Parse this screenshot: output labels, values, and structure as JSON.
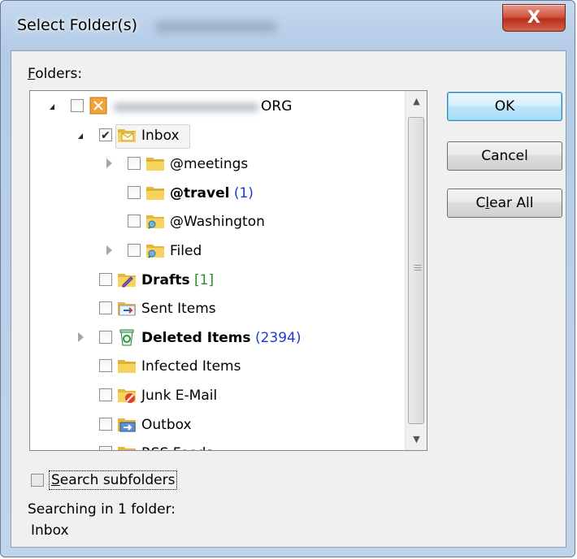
{
  "window": {
    "title": "Select Folder(s)",
    "close_glyph": "X"
  },
  "folders_label_mnemonic": "F",
  "folders_label_rest": "olders:",
  "tree": [
    {
      "label": "ORG",
      "indent": 0,
      "expander": "open",
      "icon": "exchange-account-icon",
      "checked": false,
      "bold": false
    },
    {
      "label": "Inbox",
      "indent": 1,
      "expander": "open",
      "icon": "inbox-icon",
      "checked": true,
      "bold": false,
      "selected": true
    },
    {
      "label": "@meetings",
      "indent": 2,
      "expander": "closed",
      "icon": "folder-icon",
      "checked": false,
      "bold": false
    },
    {
      "label": "@travel",
      "count": "(1)",
      "count_style": "blue",
      "indent": 2,
      "expander": "none",
      "icon": "folder-icon",
      "checked": false,
      "bold": true
    },
    {
      "label": "@Washington",
      "indent": 2,
      "expander": "none",
      "icon": "search-folder-icon",
      "checked": false,
      "bold": false
    },
    {
      "label": "Filed",
      "indent": 2,
      "expander": "closed",
      "icon": "search-folder-icon",
      "checked": false,
      "bold": false
    },
    {
      "label": "Drafts",
      "count": "[1]",
      "count_style": "green",
      "indent": 1,
      "expander": "none",
      "icon": "drafts-icon",
      "checked": false,
      "bold": true
    },
    {
      "label": "Sent Items",
      "indent": 1,
      "expander": "none",
      "icon": "sent-items-icon",
      "checked": false,
      "bold": false
    },
    {
      "label": "Deleted Items",
      "count": "(2394)",
      "count_style": "blue",
      "indent": 1,
      "expander": "closed",
      "icon": "recycle-bin-icon",
      "checked": false,
      "bold": true
    },
    {
      "label": "Infected Items",
      "indent": 1,
      "expander": "none",
      "icon": "folder-icon",
      "checked": false,
      "bold": false
    },
    {
      "label": "Junk E-Mail",
      "indent": 1,
      "expander": "none",
      "icon": "junk-mail-icon",
      "checked": false,
      "bold": false
    },
    {
      "label": "Outbox",
      "indent": 1,
      "expander": "none",
      "icon": "outbox-icon",
      "checked": false,
      "bold": false
    },
    {
      "label": "RSS Feeds",
      "indent": 1,
      "expander": "none",
      "icon": "rss-feeds-icon",
      "checked": false,
      "bold": false
    }
  ],
  "buttons": {
    "ok": "OK",
    "cancel": "Cancel",
    "clear_all_pre": "C",
    "clear_all_mnemonic": "l",
    "clear_all_post": "ear All"
  },
  "search_subfolders": {
    "mnemonic": "S",
    "rest": "earch subfolders",
    "checked": false
  },
  "status": {
    "line1": "Searching in 1 folder:",
    "line2": "Inbox"
  },
  "colors": {
    "count_blue": "#1a3dd8",
    "count_green": "#2b8a2b",
    "close_button": "#c84a35",
    "folder_yellow": "#f2c94c"
  }
}
